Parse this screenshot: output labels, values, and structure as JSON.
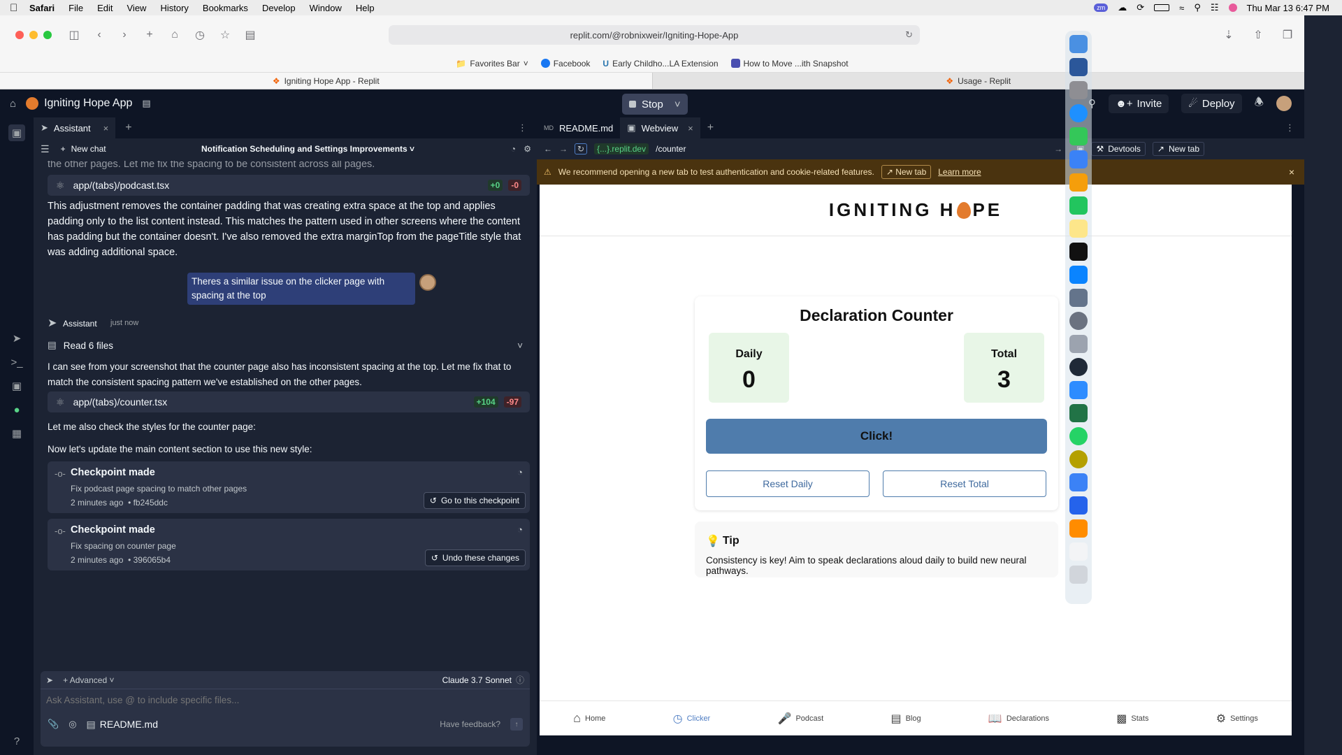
{
  "menubar": {
    "app": "Safari",
    "items": [
      "File",
      "Edit",
      "View",
      "History",
      "Bookmarks",
      "Develop",
      "Window",
      "Help"
    ],
    "datetime": "Thu Mar 13  6:47 PM",
    "zoom_badge": "zm"
  },
  "browser": {
    "url": "replit.com/@robnixweir/Igniting-Hope-App",
    "favorites": {
      "bar_label": "Favorites Bar",
      "items": [
        "Facebook",
        "Early Childho...LA Extension",
        "How to Move ...ith Snapshot"
      ]
    },
    "tabs": [
      "Igniting Hope App - Replit",
      "Usage - Replit"
    ]
  },
  "replit": {
    "app_name": "Igniting Hope App",
    "stop_label": "Stop",
    "invite_label": "Invite",
    "deploy_label": "Deploy",
    "assistant": {
      "tab_label": "Assistant",
      "new_chat_label": "New chat",
      "chat_title": "Notification Scheduling and Settings Improvements",
      "partial_top": "the other pages. Let me fix the spacing to be consistent across all pages.",
      "file1": {
        "name": "app/(tabs)/podcast.tsx",
        "adds": "+0",
        "dels": "-0"
      },
      "para1": "This adjustment removes the container padding that was creating extra space at the top and applies padding only to the list content instead. This matches the pattern used in other screens where the content has padding but the container doesn't. I've also removed the extra marginTop from the pageTitle style that was adding additional space.",
      "user_message": "Theres a similar issue on the clicker page with spacing at the top",
      "assistant_name": "Assistant",
      "assistant_time": "just now",
      "read_files": "Read 6 files",
      "para2": "I can see from your screenshot that the counter page also has inconsistent spacing at the top. Let me fix that to match the consistent spacing pattern we've established on the other pages.",
      "file2": {
        "name": "app/(tabs)/counter.tsx",
        "adds": "+104",
        "dels": "-97"
      },
      "para3": "Let me also check the styles for the counter page:",
      "para4": "Now let's update the main content section to use this new style:",
      "checkpoints": [
        {
          "title": "Checkpoint made",
          "desc": "Fix podcast page spacing to match other pages",
          "time": "2 minutes ago",
          "hash": "• fb245ddc",
          "action": "Go to this checkpoint"
        },
        {
          "title": "Checkpoint made",
          "desc": "Fix spacing on counter page",
          "time": "2 minutes ago",
          "hash": "• 396065b4",
          "action": "Undo these changes"
        }
      ],
      "advanced_label": "Advanced",
      "model_label": "Claude 3.7 Sonnet",
      "input_placeholder": "Ask Assistant, use @ to include specific files...",
      "attached_file": "README.md",
      "feedback_label": "Have feedback?"
    },
    "webview": {
      "tabs": [
        "README.md",
        "Webview"
      ],
      "domain": "{...}.replit.dev",
      "path": "/counter",
      "devtools_label": "Devtools",
      "newtab_label": "New tab",
      "warning": "We recommend opening a new tab to test authentication and cookie-related features.",
      "warning_newtab": "New tab",
      "learn_more": "Learn more"
    }
  },
  "app_preview": {
    "logo_left": "IGNITING H",
    "logo_right": "PE",
    "counter_title": "Declaration Counter",
    "daily_label": "Daily",
    "daily_value": "0",
    "total_label": "Total",
    "total_value": "3",
    "click_label": "Click!",
    "reset_daily": "Reset Daily",
    "reset_total": "Reset Total",
    "tip_title": "Tip",
    "tip_text": "Consistency is key! Aim to speak declarations aloud daily to build new neural pathways.",
    "nav": [
      "Home",
      "Clicker",
      "Podcast",
      "Blog",
      "Declarations",
      "Stats",
      "Settings"
    ]
  },
  "colors": {
    "replit_bg": "#0e1525",
    "panel_bg": "#1c2333",
    "user_bubble": "#2e3f78",
    "click_button": "#4f7cac",
    "stat_box": "#e8f6e7",
    "warning_bg": "#4a330f",
    "logo_accent": "#e37b2d"
  }
}
